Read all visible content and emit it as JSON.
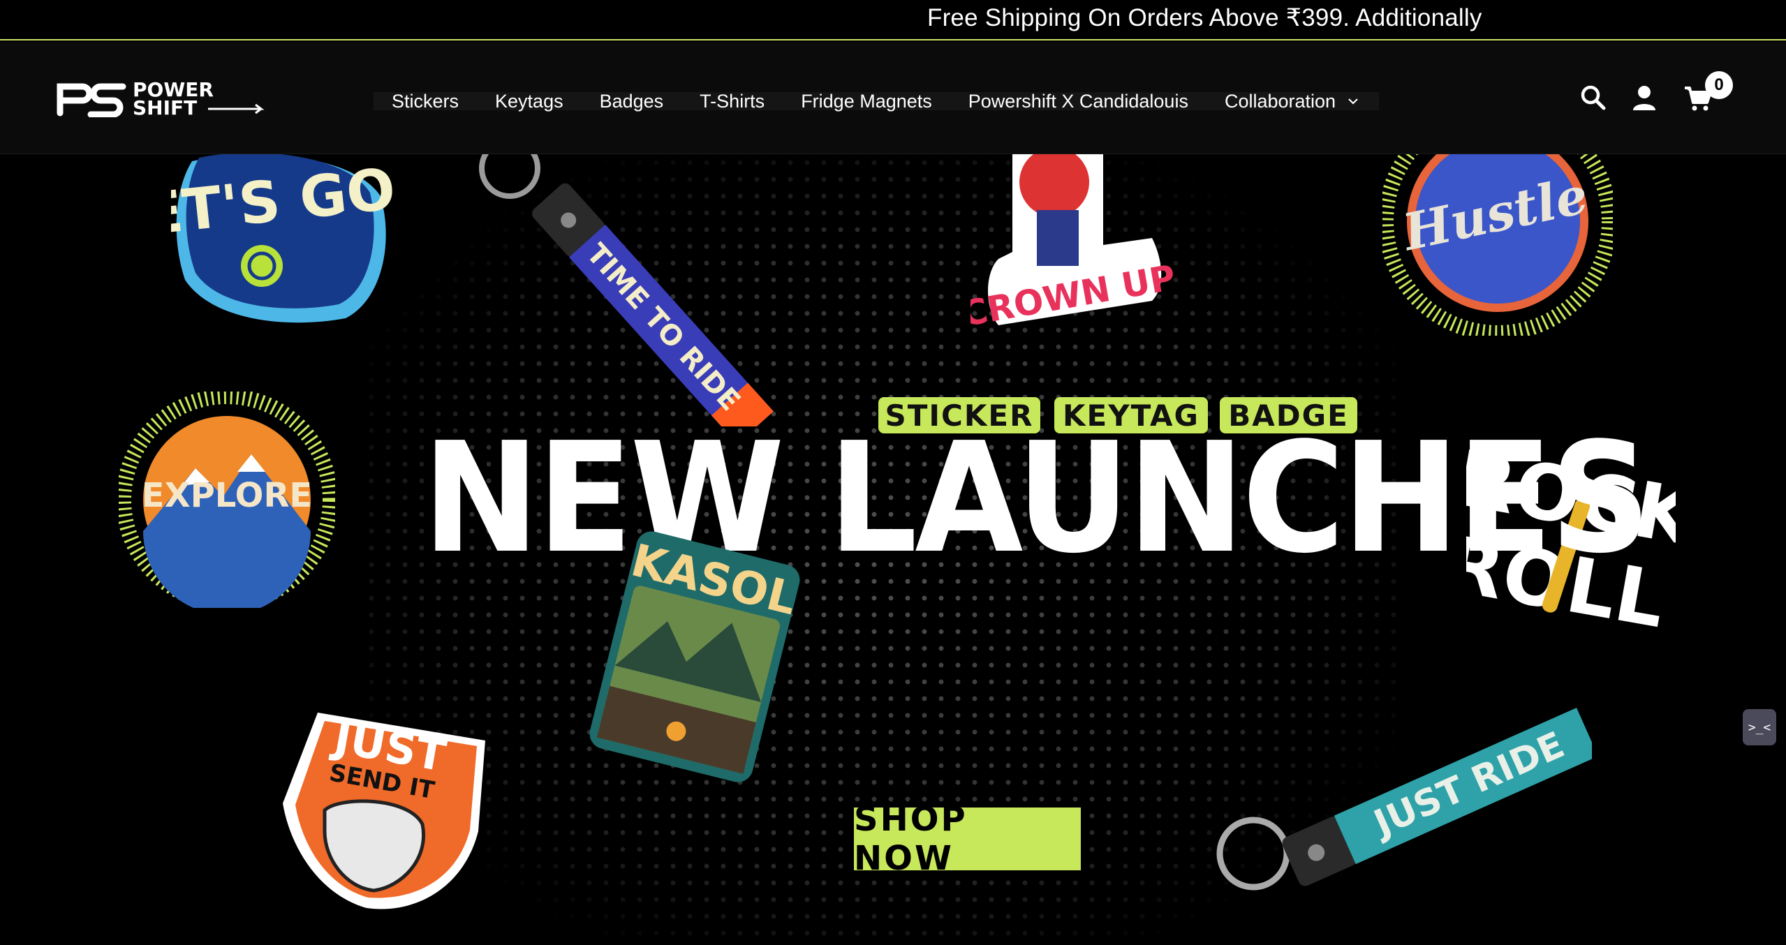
{
  "announcement": {
    "text": "Free Shipping On Orders Above ₹399. Additionally"
  },
  "brand": {
    "logo_line1": "POWER",
    "logo_line2": "SHIFT",
    "logo_mark": "PS",
    "accent": "#c7e85a"
  },
  "nav": {
    "items": [
      {
        "label": "Stickers"
      },
      {
        "label": "Keytags"
      },
      {
        "label": "Badges"
      },
      {
        "label": "T-Shirts"
      },
      {
        "label": "Fridge Magnets"
      },
      {
        "label": "Powershift X Candidalouis"
      },
      {
        "label": "Collaboration"
      }
    ]
  },
  "header_icons": {
    "search": "search-icon",
    "account": "user-icon",
    "cart": "cart-icon",
    "cart_count": "0"
  },
  "hero": {
    "tags": [
      "STICKER",
      "KEYTAG",
      "BADGE"
    ],
    "headline": "NEW LAUNCHES",
    "cta": "SHOP NOW",
    "stickers": {
      "lets_go": "LET'S GO!!",
      "time_to_ride": "TIME TO RIDE",
      "crown_up": "CROWN UP",
      "hustle": "Hustle",
      "explore": "EXPLORE",
      "rock_roll_1": "ROCK",
      "rock_roll_2": "ROLL",
      "kasol": "KASOL",
      "just_send_it_1": "JUST",
      "just_send_it_2": "SEND IT",
      "just_ride": "JUST RIDE"
    }
  },
  "widget": {
    "label": ">_<"
  }
}
